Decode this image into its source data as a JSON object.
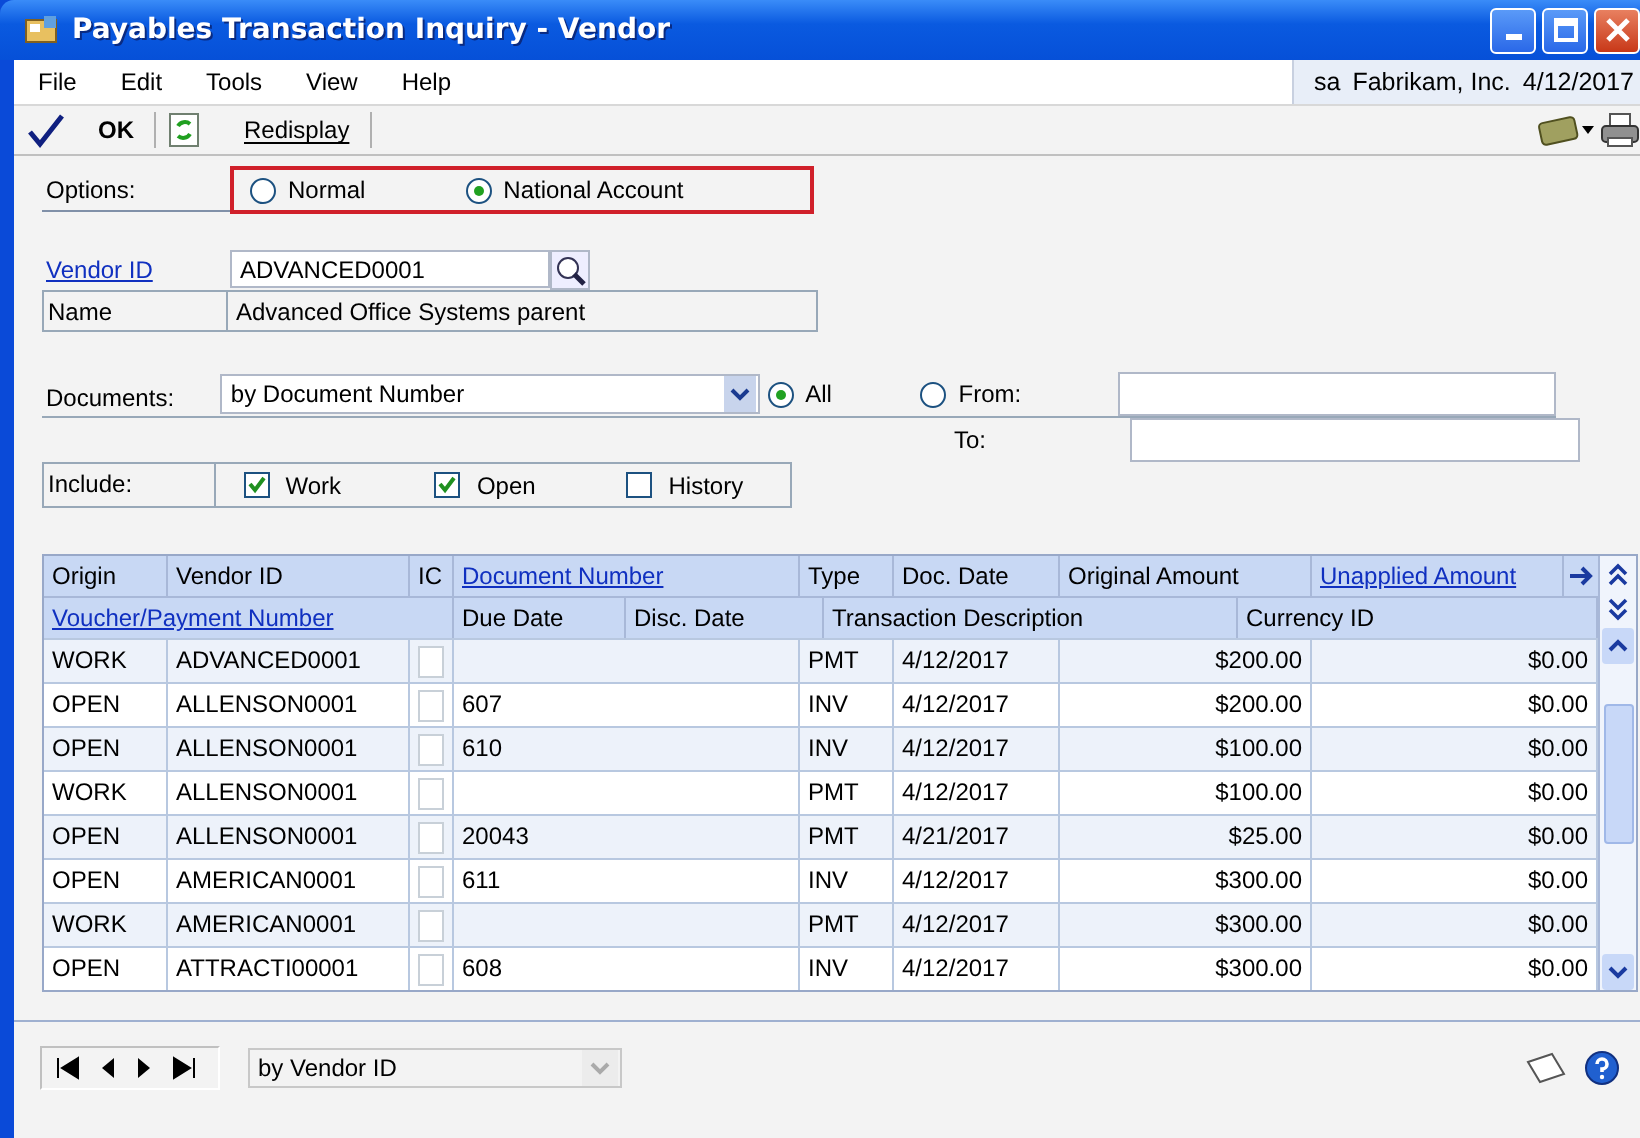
{
  "window": {
    "title": "Payables Transaction Inquiry - Vendor"
  },
  "menu": [
    "File",
    "Edit",
    "Tools",
    "View",
    "Help"
  ],
  "session": {
    "user": "sa",
    "company": "Fabrikam, Inc.",
    "date": "4/12/2017"
  },
  "toolbar": {
    "ok": "OK",
    "redisplay": "Redisplay"
  },
  "options": {
    "label": "Options:",
    "choices": [
      {
        "label": "Normal",
        "selected": false
      },
      {
        "label": "National Account",
        "selected": true
      }
    ]
  },
  "vendor": {
    "id_label": "Vendor ID",
    "id_value": "ADVANCED0001",
    "name_label": "Name",
    "name_value": "Advanced Office Systems parent"
  },
  "documents": {
    "label": "Documents:",
    "sort": "by Document Number",
    "range": [
      {
        "label": "All",
        "selected": true
      },
      {
        "label": "From:",
        "selected": false
      }
    ],
    "to_label": "To:"
  },
  "include": {
    "label": "Include:",
    "options": [
      {
        "label": "Work",
        "checked": true
      },
      {
        "label": "Open",
        "checked": true
      },
      {
        "label": "History",
        "checked": false
      }
    ]
  },
  "grid": {
    "header_1": [
      {
        "label": "Origin",
        "link": false
      },
      {
        "label": "Vendor ID",
        "link": false
      },
      {
        "label": "IC",
        "link": false
      },
      {
        "label": "Document Number",
        "link": true
      },
      {
        "label": "Type",
        "link": false
      },
      {
        "label": "Doc. Date",
        "link": false
      },
      {
        "label": "Original Amount",
        "link": false
      },
      {
        "label": "Unapplied Amount",
        "link": true
      }
    ],
    "header_2": [
      {
        "label": "Voucher/Payment Number",
        "link": true
      },
      {
        "label": "Due Date",
        "link": false
      },
      {
        "label": "Disc. Date",
        "link": false
      },
      {
        "label": "Transaction Description",
        "link": false
      },
      {
        "label": "Currency ID",
        "link": false
      }
    ],
    "rows": [
      {
        "origin": "WORK",
        "vendor_id": "ADVANCED0001",
        "ic": false,
        "document_number": "",
        "type": "PMT",
        "doc_date": "4/12/2017",
        "original_amount": "$200.00",
        "unapplied_amount": "$0.00"
      },
      {
        "origin": "OPEN",
        "vendor_id": "ALLENSON0001",
        "ic": false,
        "document_number": "607",
        "type": "INV",
        "doc_date": "4/12/2017",
        "original_amount": "$200.00",
        "unapplied_amount": "$0.00"
      },
      {
        "origin": "OPEN",
        "vendor_id": "ALLENSON0001",
        "ic": false,
        "document_number": "610",
        "type": "INV",
        "doc_date": "4/12/2017",
        "original_amount": "$100.00",
        "unapplied_amount": "$0.00"
      },
      {
        "origin": "WORK",
        "vendor_id": "ALLENSON0001",
        "ic": false,
        "document_number": "",
        "type": "PMT",
        "doc_date": "4/12/2017",
        "original_amount": "$100.00",
        "unapplied_amount": "$0.00"
      },
      {
        "origin": "OPEN",
        "vendor_id": "ALLENSON0001",
        "ic": false,
        "document_number": "20043",
        "type": "PMT",
        "doc_date": "4/21/2017",
        "original_amount": "$25.00",
        "unapplied_amount": "$0.00"
      },
      {
        "origin": "OPEN",
        "vendor_id": "AMERICAN0001",
        "ic": false,
        "document_number": "611",
        "type": "INV",
        "doc_date": "4/12/2017",
        "original_amount": "$300.00",
        "unapplied_amount": "$0.00"
      },
      {
        "origin": "WORK",
        "vendor_id": "AMERICAN0001",
        "ic": false,
        "document_number": "",
        "type": "PMT",
        "doc_date": "4/12/2017",
        "original_amount": "$300.00",
        "unapplied_amount": "$0.00"
      },
      {
        "origin": "OPEN",
        "vendor_id": "ATTRACTI00001",
        "ic": false,
        "document_number": "608",
        "type": "INV",
        "doc_date": "4/12/2017",
        "original_amount": "$300.00",
        "unapplied_amount": "$0.00"
      }
    ]
  },
  "footer": {
    "sort": "by Vendor ID"
  }
}
